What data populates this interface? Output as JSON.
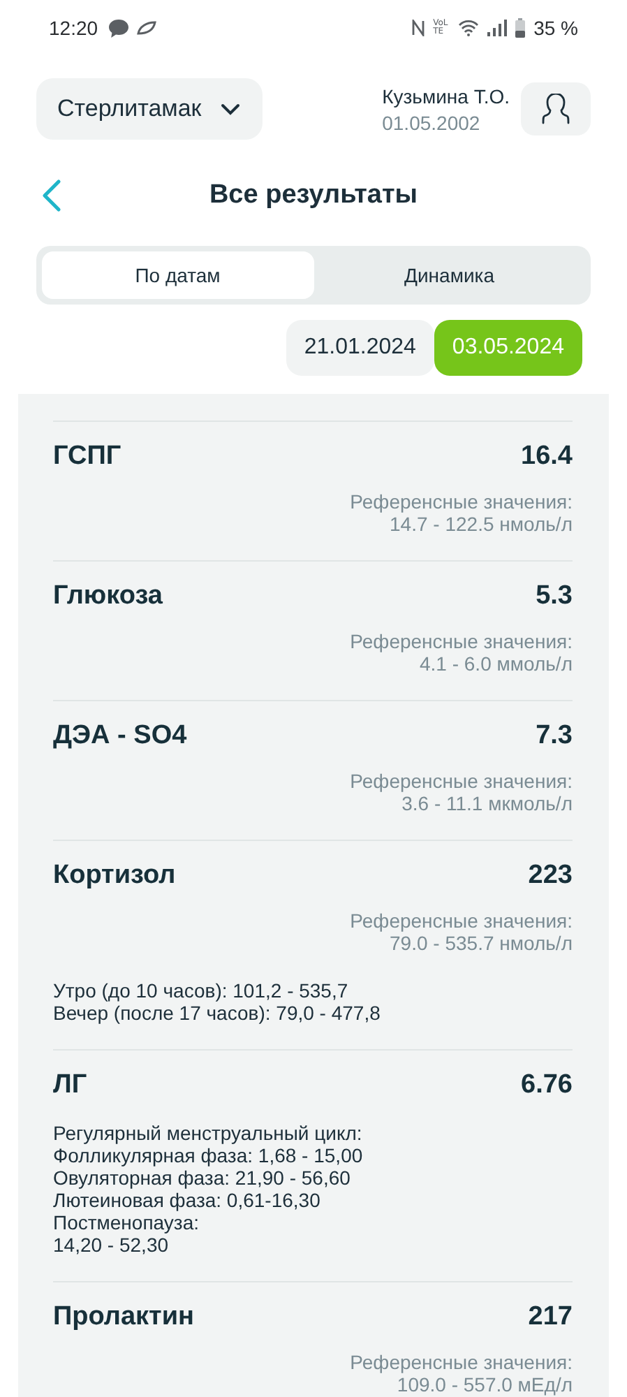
{
  "status_bar": {
    "time": "12:20",
    "network_label": "VoLTE",
    "battery": "35 %"
  },
  "header": {
    "city": "Стерлитамак",
    "patient_name": "Кузьмина Т.О.",
    "birth_date": "01.05.2002"
  },
  "page_title": "Все результаты",
  "tabs": [
    {
      "label": "По датам",
      "selected": true
    },
    {
      "label": "Динамика",
      "selected": false
    }
  ],
  "dates": [
    {
      "label": "21.01.2024",
      "selected": false
    },
    {
      "label": "03.05.2024",
      "selected": true
    }
  ],
  "results": [
    {
      "name": "ГСПГ",
      "value": "16.4",
      "reference": {
        "label": "Референсные значения:",
        "range": "14.7 - 122.5 нмоль/л"
      }
    },
    {
      "name": "Глюкоза",
      "value": "5.3",
      "reference": {
        "label": "Референсные значения:",
        "range": "4.1 - 6.0 ммоль/л"
      }
    },
    {
      "name": "ДЭА - SO4",
      "value": "7.3",
      "reference": {
        "label": "Референсные значения:",
        "range": "3.6 - 11.1 мкмоль/л"
      }
    },
    {
      "name": "Кортизол",
      "value": "223",
      "reference": {
        "label": "Референсные значения:",
        "range": "79.0 - 535.7 нмоль/л"
      },
      "notes": [
        "Утро (до 10 часов): 101,2 - 535,7",
        "Вечер (после 17 часов): 79,0 - 477,8"
      ]
    },
    {
      "name": "ЛГ",
      "value": "6.76",
      "notes": [
        "Регулярный менструальный цикл:",
        "Фолликулярная фаза: 1,68 - 15,00",
        "Овуляторная фаза: 21,90 - 56,60",
        "Лютеиновая фаза: 0,61-16,30",
        "Постменопауза:",
        "14,20 - 52,30"
      ]
    },
    {
      "name": "Пролактин",
      "value": "217",
      "reference": {
        "label": "Референсные значения:",
        "range": "109.0 - 557.0 мЕд/л"
      }
    }
  ]
}
